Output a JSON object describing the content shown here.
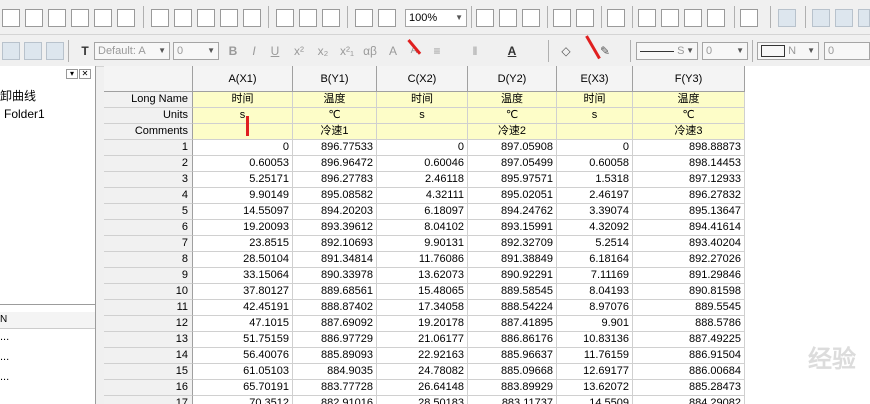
{
  "toolbar": {
    "zoom_value": "100%",
    "font_name": "Default: A",
    "font_size": "0",
    "format_buttons": [
      "B",
      "I",
      "U",
      "x²",
      "x₂",
      "x²₁",
      "αβ",
      "A",
      "A"
    ],
    "line_style_label": "S",
    "line_width": "0",
    "fill_label": "N",
    "fill_value": "0"
  },
  "left_panel": {
    "tree_items": [
      "卸曲线",
      "Folder1"
    ],
    "bottom_header": "N",
    "bottom_items": [
      "...",
      "...",
      "..."
    ]
  },
  "columns": [
    {
      "name": "A(X1)",
      "long_name": "时间",
      "units": "s",
      "comments": ""
    },
    {
      "name": "B(Y1)",
      "long_name": "温度",
      "units": "℃",
      "comments": "冷速1"
    },
    {
      "name": "C(X2)",
      "long_name": "时间",
      "units": "s",
      "comments": ""
    },
    {
      "name": "D(Y2)",
      "long_name": "温度",
      "units": "℃",
      "comments": "冷速2"
    },
    {
      "name": "E(X3)",
      "long_name": "时间",
      "units": "s",
      "comments": ""
    },
    {
      "name": "F(Y3)",
      "long_name": "温度",
      "units": "℃",
      "comments": "冷速3"
    }
  ],
  "row_labels": [
    "Long Name",
    "Units",
    "Comments"
  ],
  "rows": [
    [
      "1",
      "0",
      "896.77533",
      "0",
      "897.05908",
      "0",
      "898.88873"
    ],
    [
      "2",
      "0.60053",
      "896.96472",
      "0.60046",
      "897.05499",
      "0.60058",
      "898.14453"
    ],
    [
      "3",
      "5.25171",
      "896.27783",
      "2.46118",
      "895.97571",
      "1.5318",
      "897.12933"
    ],
    [
      "4",
      "9.90149",
      "895.08582",
      "4.32111",
      "895.02051",
      "2.46197",
      "896.27832"
    ],
    [
      "5",
      "14.55097",
      "894.20203",
      "6.18097",
      "894.24762",
      "3.39074",
      "895.13647"
    ],
    [
      "6",
      "19.20093",
      "893.39612",
      "8.04102",
      "893.15991",
      "4.32092",
      "894.41614"
    ],
    [
      "7",
      "23.8515",
      "892.10693",
      "9.90131",
      "892.32709",
      "5.2514",
      "893.40204"
    ],
    [
      "8",
      "28.50104",
      "891.34814",
      "11.76086",
      "891.38849",
      "6.18164",
      "892.27026"
    ],
    [
      "9",
      "33.15064",
      "890.33978",
      "13.62073",
      "890.92291",
      "7.11169",
      "891.29846"
    ],
    [
      "10",
      "37.80127",
      "889.68561",
      "15.48065",
      "889.58545",
      "8.04193",
      "890.81598"
    ],
    [
      "11",
      "42.45191",
      "888.87402",
      "17.34058",
      "888.54224",
      "8.97076",
      "889.5545"
    ],
    [
      "12",
      "47.1015",
      "887.69092",
      "19.20178",
      "887.41895",
      "9.901",
      "888.5786"
    ],
    [
      "13",
      "51.75159",
      "886.97729",
      "21.06177",
      "886.86176",
      "10.83136",
      "887.49225"
    ],
    [
      "14",
      "56.40076",
      "885.89093",
      "22.92163",
      "885.96637",
      "11.76159",
      "886.91504"
    ],
    [
      "15",
      "61.05103",
      "884.9035",
      "24.78082",
      "885.09668",
      "12.69177",
      "886.00684"
    ],
    [
      "16",
      "65.70191",
      "883.77728",
      "26.64148",
      "883.89929",
      "13.62072",
      "885.28473"
    ],
    [
      "17",
      "70.3512",
      "882.91016",
      "28.50183",
      "883.11737",
      "14.5509",
      "884.29082"
    ]
  ],
  "watermark": "经验"
}
